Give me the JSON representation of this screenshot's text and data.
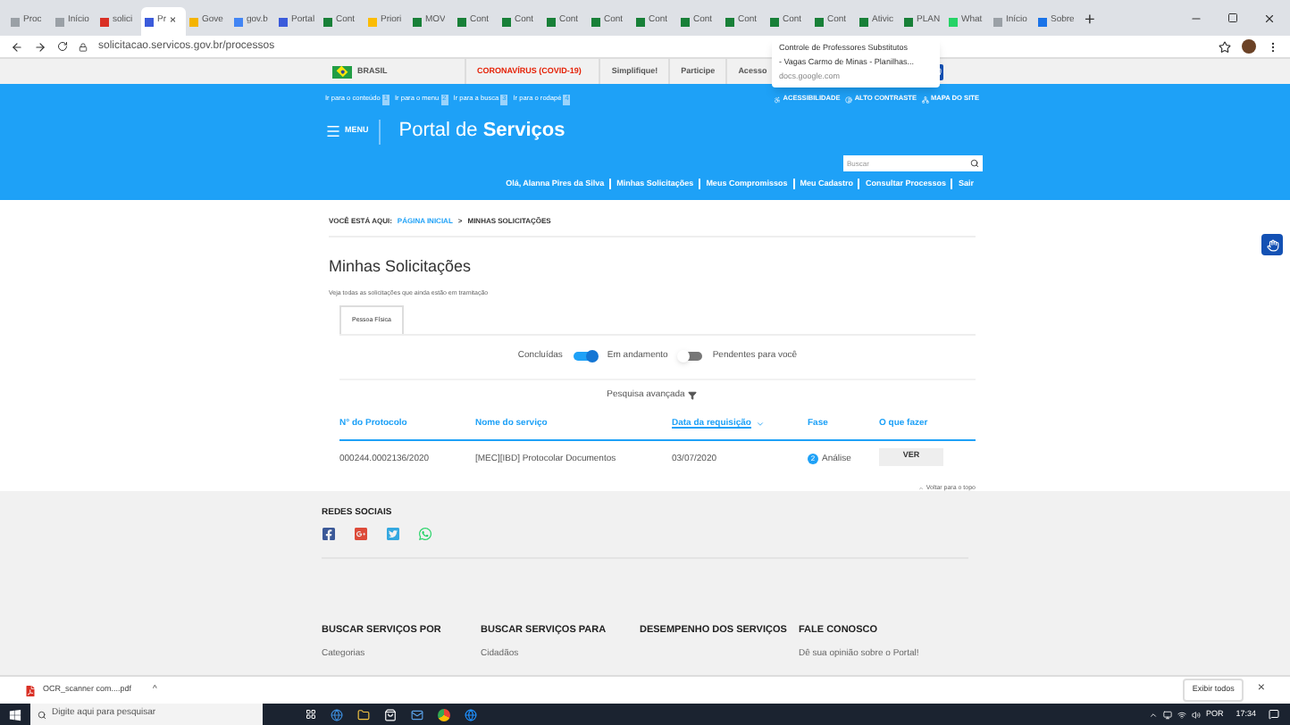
{
  "browser": {
    "tabs": [
      {
        "label": "Proc",
        "color": "#9aa0a6",
        "selected": false
      },
      {
        "label": "Início",
        "color": "#9aa0a6",
        "selected": false
      },
      {
        "label": "solici",
        "color": "#d93025",
        "selected": false
      },
      {
        "label": "Pr",
        "color": "#3b5bdb",
        "selected": true
      },
      {
        "label": "Gove",
        "color": "#f4b400",
        "selected": false
      },
      {
        "label": "gov.b",
        "color": "#4285f4",
        "selected": false
      },
      {
        "label": "Portal",
        "color": "#3b5bdb",
        "selected": false
      },
      {
        "label": "Cont",
        "color": "#188038",
        "selected": false
      },
      {
        "label": "Priori",
        "color": "#fbbc04",
        "selected": false
      },
      {
        "label": "MOV",
        "color": "#188038",
        "selected": false
      },
      {
        "label": "Cont",
        "color": "#188038",
        "selected": false
      },
      {
        "label": "Cont",
        "color": "#188038",
        "selected": false
      },
      {
        "label": "Cont",
        "color": "#188038",
        "selected": false
      },
      {
        "label": "Cont",
        "color": "#188038",
        "selected": false
      },
      {
        "label": "Cont",
        "color": "#188038",
        "selected": false
      },
      {
        "label": "Cont",
        "color": "#188038",
        "selected": false
      },
      {
        "label": "Cont",
        "color": "#188038",
        "selected": false
      },
      {
        "label": "Cont",
        "color": "#188038",
        "selected": false
      },
      {
        "label": "Cont",
        "color": "#188038",
        "selected": false
      },
      {
        "label": "Ativic",
        "color": "#188038",
        "selected": false
      },
      {
        "label": "PLAN",
        "color": "#188038",
        "selected": false
      },
      {
        "label": "What",
        "color": "#25d366",
        "selected": false
      },
      {
        "label": "Início",
        "color": "#9aa0a6",
        "selected": false
      },
      {
        "label": "Sobre",
        "color": "#1a73e8",
        "selected": false
      }
    ],
    "close_glyph": "×",
    "new_tab": "+",
    "address": "solicitacao.servicos.gov.br/processos",
    "tooltip": {
      "lines": [
        "Controle de Professores Substitutos",
        "- Vagas Carmo de Minas - Planilhas..."
      ],
      "domain": "docs.google.com"
    }
  },
  "gov_bar": {
    "brand": "BRASIL",
    "links": [
      "CORONAVÍRUS (COVID-19)",
      "Simplifique!",
      "Participe",
      "Acesso"
    ]
  },
  "header": {
    "skip_links": [
      {
        "label": "Ir para o conteúdo",
        "key": "1"
      },
      {
        "label": "Ir para o menu",
        "key": "2"
      },
      {
        "label": "Ir para a busca",
        "key": "3"
      },
      {
        "label": "Ir para o rodapé",
        "key": "4"
      }
    ],
    "tools": [
      "ACESSIBILIDADE",
      "ALTO CONTRASTE",
      "MAPA DO SITE"
    ],
    "menu": "MENU",
    "title": "Portal de **Serviços**",
    "search": {
      "placeholder": "Buscar"
    },
    "nav": [
      "Olá, Alanna Pires da Silva",
      "Minhas Solicitações",
      "Meus Compromissos",
      "Meu Cadastro",
      "Consultar Processos",
      "Sair"
    ]
  },
  "breadcrumb": {
    "label": "VOCÊ ESTÁ AQUI:",
    "home": "PÁGINA INICIAL",
    "sep": ">",
    "current": "MINHAS SOLICITAÇÕES"
  },
  "page": {
    "title": "Minhas Solicitações",
    "subtitle": "Veja todas as solicitações que ainda estão em tramitação",
    "tabs": [
      {
        "label": "Pessoa Física",
        "selected": true
      }
    ],
    "filters": [
      {
        "kind": "label",
        "text": "Concluídas"
      },
      {
        "kind": "switch",
        "on": true
      },
      {
        "kind": "label",
        "text": "Em andamento"
      },
      {
        "kind": "switch",
        "on": false
      },
      {
        "kind": "label",
        "text": "Pendentes para você"
      }
    ],
    "advanced": "Pesquisa avançada",
    "table": {
      "columns": [
        {
          "label": "N° do Protocolo",
          "sorted": false
        },
        {
          "label": "Nome do serviço",
          "sorted": false
        },
        {
          "label": "Data da requisição",
          "sorted": true
        },
        {
          "label": "Fase",
          "sorted": false
        },
        {
          "label": "O que fazer",
          "sorted": false
        }
      ],
      "rows": [
        {
          "protocol": "000244.0002136/2020",
          "service": "[MEC][IBD] Protocolar Documentos",
          "date": "03/07/2020",
          "phase_step": "2",
          "phase": "Análise",
          "action": "VER"
        }
      ]
    },
    "back_to_top": "Voltar para o topo"
  },
  "footer": {
    "social_title": "REDES SOCIAIS",
    "columns": [
      {
        "title": "BUSCAR SERVIÇOS POR",
        "item": "Categorias"
      },
      {
        "title": "BUSCAR SERVIÇOS PARA",
        "item": "Cidadãos"
      },
      {
        "title": "DESEMPENHO DOS SERVIÇOS"
      },
      {
        "title": "FALE CONOSCO",
        "item": "Dê sua opinião sobre o Portal!"
      }
    ]
  },
  "downloads": {
    "file": "OCR_scanner com....pdf",
    "caret": "^",
    "show_all": "Exibir todos",
    "close": "×"
  },
  "taskbar": {
    "search_placeholder": "Digite aqui para pesquisar",
    "lang": "POR",
    "time": "17:34"
  }
}
